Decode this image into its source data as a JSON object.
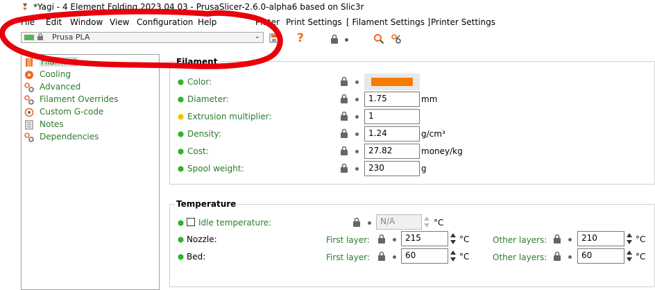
{
  "window": {
    "title": "*Yagi - 4 Element Folding 2023 04 03 - PrusaSlicer-2.6.0-alpha6 based on Slic3r"
  },
  "menu": [
    "File",
    "Edit",
    "Window",
    "View",
    "Configuration",
    "Help"
  ],
  "tabs": [
    "Plater",
    "Print Settings",
    "[ Filament Settings ]",
    "Printer Settings"
  ],
  "toolbar": {
    "preset": "Prusa PLA",
    "help": "?"
  },
  "sidebar": {
    "items": [
      {
        "label": "Filament",
        "icon": "spool-icon",
        "selected": true
      },
      {
        "label": "Cooling",
        "icon": "fan-icon"
      },
      {
        "label": "Advanced",
        "icon": "wrench-icon"
      },
      {
        "label": "Filament Overrides",
        "icon": "wrench-icon"
      },
      {
        "label": "Custom G-code",
        "icon": "gear-icon"
      },
      {
        "label": "Notes",
        "icon": "notes-icon"
      },
      {
        "label": "Dependencies",
        "icon": "wrench-icon"
      }
    ]
  },
  "filament": {
    "title": "Filament",
    "color_label": "Color:",
    "color_value": "#f57c00",
    "diameter_label": "Diameter:",
    "diameter": "1.75",
    "diameter_unit": "mm",
    "extrusion_label": "Extrusion multiplier:",
    "extrusion": "1",
    "density_label": "Density:",
    "density": "1.24",
    "density_unit": "g/cm³",
    "cost_label": "Cost:",
    "cost": "27.82",
    "cost_unit": "money/kg",
    "spool_label": "Spool weight:",
    "spool": "230",
    "spool_unit": "g"
  },
  "temperature": {
    "title": "Temperature",
    "idle_label": "Idle temperature:",
    "idle_value": "N/A",
    "unit": "°C",
    "nozzle_label": "Nozzle:",
    "bed_label": "Bed:",
    "first_layer": "First layer:",
    "other_layers": "Other layers:",
    "nozzle_first": "215",
    "nozzle_other": "210",
    "bed_first": "60",
    "bed_other": "60"
  },
  "colors": {
    "accent_green": "#2b7a2b",
    "annotation_red": "#e8000b",
    "orange": "#ed6b21"
  }
}
